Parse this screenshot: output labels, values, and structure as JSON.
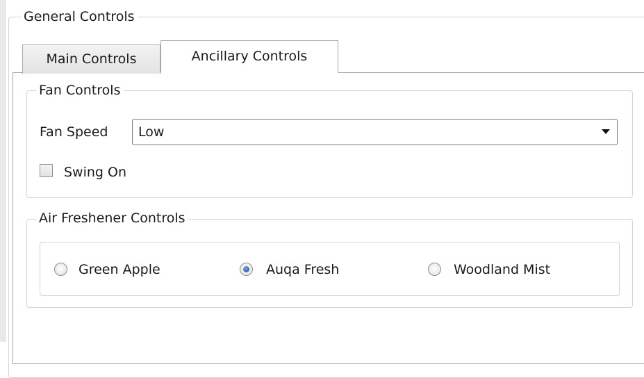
{
  "general_controls": {
    "title": "General Controls",
    "tabs": [
      {
        "label": "Main Controls",
        "selected": false
      },
      {
        "label": "Ancillary Controls",
        "selected": true
      }
    ]
  },
  "fan_controls": {
    "title": "Fan Controls",
    "fan_speed_label": "Fan Speed",
    "fan_speed_value": "Low",
    "swing_label": "Swing On",
    "swing_checked": false
  },
  "air_freshener": {
    "title": "Air Freshener Controls",
    "options": [
      {
        "label": "Green Apple",
        "selected": false
      },
      {
        "label": "Auqa Fresh",
        "selected": true
      },
      {
        "label": "Woodland Mist",
        "selected": false
      }
    ]
  },
  "colors": {
    "group_border": "#d3d3d3",
    "tab_border": "#a6a6a6",
    "radio_selected": "#1d4f9a"
  }
}
